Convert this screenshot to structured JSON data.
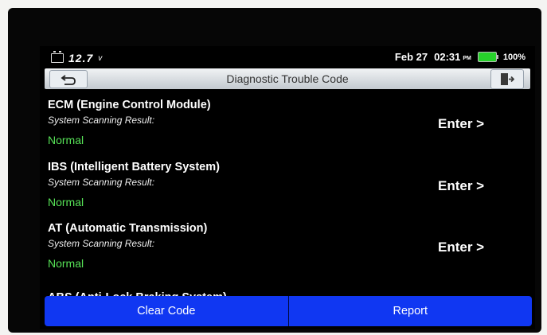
{
  "status": {
    "voltage": "12.7",
    "voltage_unit": "v",
    "date": "Feb 27",
    "time": "02:31",
    "ampm": "PM",
    "battery_percent": "100%"
  },
  "header": {
    "title": "Diagnostic Trouble Code"
  },
  "modules": [
    {
      "name": "ECM (Engine Control Module)",
      "scan_label": "System Scanning Result:",
      "result": "Normal",
      "action": "Enter >"
    },
    {
      "name": "IBS (Intelligent Battery System)",
      "scan_label": "System Scanning Result:",
      "result": "Normal",
      "action": "Enter >"
    },
    {
      "name": "AT (Automatic Transmission)",
      "scan_label": "System Scanning Result:",
      "result": "Normal",
      "action": "Enter >"
    },
    {
      "name": "ABS (Anti-Lock Braking System)"
    }
  ],
  "footer": {
    "clear_label": "Clear Code",
    "report_label": "Report"
  },
  "colors": {
    "accent_blue": "#1037f2",
    "normal_green": "#57e257",
    "battery_green": "#27d12b"
  }
}
